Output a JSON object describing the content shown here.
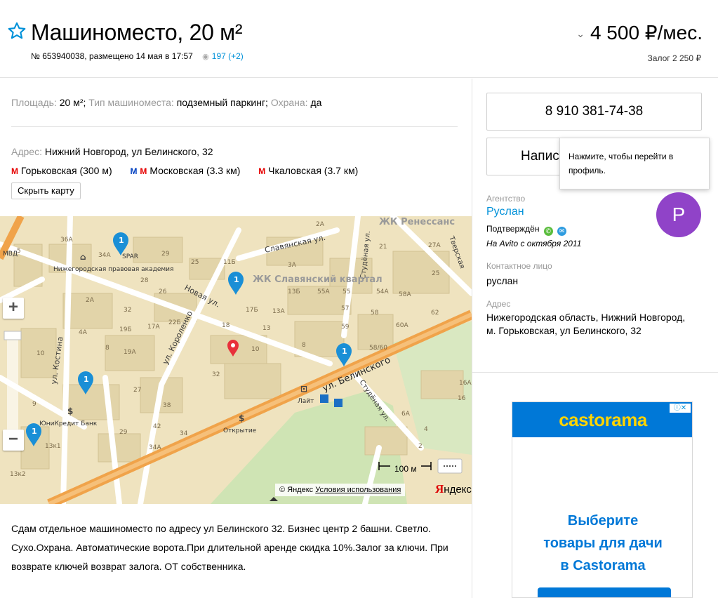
{
  "header": {
    "title": "Машиноместо, 20 м²",
    "ad_number": "№ 653940038, размещено 14 мая в 17:57",
    "views": "197 (+2)",
    "price": "4 500 ₽/мес.",
    "deposit": "Залог 2 250 ₽"
  },
  "params": {
    "area_label": "Площадь:",
    "area_value": "20 м²;",
    "type_label": "Тип машиноместа:",
    "type_value": "подземный паркинг;",
    "guard_label": "Охрана:",
    "guard_value": "да"
  },
  "address": {
    "label": "Адрес:",
    "value": "Нижний Новгород, ул Белинского, 32",
    "metro": [
      {
        "name": "Горьковская (300 м)",
        "line_color": "#e60000"
      },
      {
        "name": "Московская (3.3 км)",
        "line_color": "#0040c0"
      },
      {
        "name": "Чкаловская (3.7 км)",
        "line_color": "#e60000"
      }
    ],
    "hide_map_label": "Скрыть карту"
  },
  "map": {
    "labels": {
      "renessans": "ЖК Ренессанс",
      "slavyansky": "ЖК Славянский квартал",
      "slavyanskaya": "Славянская ул.",
      "novaya": "Новая ул.",
      "studenaya": "Студёная ул.",
      "studenaya2": "Студёная ул.",
      "belinskogo": "ул. Белинского",
      "korolenko": "ул. Короленко",
      "kostina": "ул. Костина",
      "tverskaya": "Тверская",
      "academy": "Нижегородская правовая академия",
      "mvd": "МВД",
      "spar": "SPAR",
      "unicredit": "ЮниКредит Банк",
      "otkrytie": "Открытие",
      "layt": "Лайт"
    },
    "scale": "100 м",
    "copyright": "© Яндекс",
    "terms": "Условия использования",
    "brand_first": "Я",
    "brand_rest": "ндекс"
  },
  "description": "Сдам отдельное машиноместо по адресу ул Белинского 32. Бизнес центр 2 башни. Светло. Сухо.Охрана. Автоматические ворота.При длительной аренде скидка 10%.Залог за ключи. При возврате ключей возврат залога. ОТ собственника.",
  "seller": {
    "phone": "8 910 381-74-38",
    "write_label": "Написать сообщение",
    "tooltip": "Нажмите, чтобы перейти в профиль.",
    "avatar_letter": "Р",
    "avatar_color": "#9043c8",
    "agency_label": "Агентство",
    "name": "Руслан",
    "verified": "Подтверждён",
    "since": "На Avito с октября 2011",
    "contact_label": "Контактное лицо",
    "contact_name": "руслан",
    "address_label": "Адрес",
    "address": "Нижегородская область, Нижний Новгород, м. Горьковская, ул Белинского, 32"
  },
  "ad_banner": {
    "brand": "castorama",
    "line1": "Выберите",
    "line2": "товары для дачи",
    "line3": "в Castorama",
    "brand_color": "#0078d7",
    "logo_color": "#ffd400"
  }
}
